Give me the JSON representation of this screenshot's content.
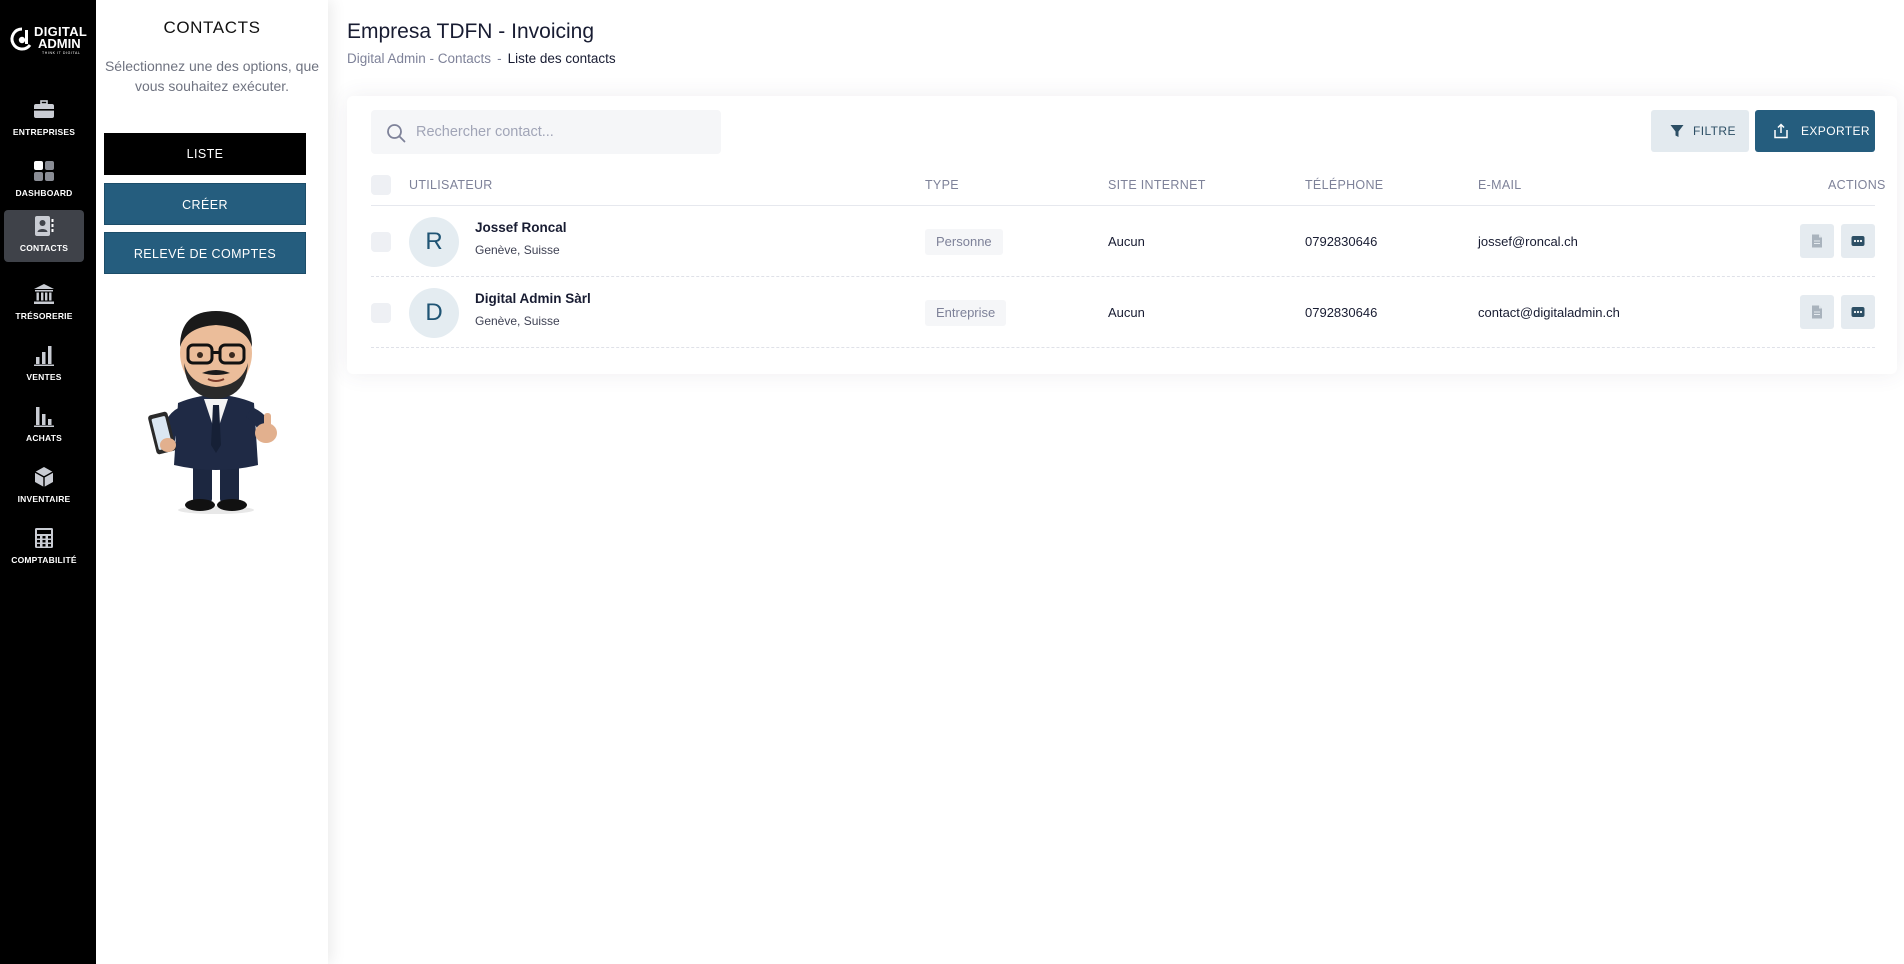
{
  "brand": {
    "line1": "DIGITAL",
    "line2": "ADMIN",
    "tagline": "THINK IT DIGITAL"
  },
  "nav": [
    {
      "label": "ENTREPRISES",
      "icon": "briefcase-icon"
    },
    {
      "label": "DASHBOARD",
      "icon": "dashboard-icon"
    },
    {
      "label": "CONTACTS",
      "icon": "contact-card-icon",
      "active": true
    },
    {
      "label": "TRÉSORERIE",
      "icon": "bank-icon"
    },
    {
      "label": "VENTES",
      "icon": "bar-chart-icon"
    },
    {
      "label": "ACHATS",
      "icon": "bar-chart-icon"
    },
    {
      "label": "INVENTAIRE",
      "icon": "box-icon"
    },
    {
      "label": "COMPTABILITÉ",
      "icon": "calculator-icon"
    }
  ],
  "sidebar": {
    "title": "CONTACTS",
    "subtitle": "Sélectionnez une des options, que vous souhaitez exécuter.",
    "buttons": [
      {
        "label": "LISTE"
      },
      {
        "label": "CRÉER"
      },
      {
        "label": "RELEVÉ DE COMPTES"
      }
    ]
  },
  "header": {
    "title": "Empresa TDFN - Invoicing",
    "breadcrumb": {
      "parent": "Digital Admin - Contacts",
      "separator": "-",
      "current": "Liste des contacts"
    }
  },
  "toolbar": {
    "search_placeholder": "Rechercher contact...",
    "filter_label": "FILTRE",
    "export_label": "EXPORTER"
  },
  "table": {
    "columns": {
      "user": "UTILISATEUR",
      "type": "TYPE",
      "website": "SITE INTERNET",
      "phone": "TÉLÉPHONE",
      "email": "E-MAIL",
      "actions": "ACTIONS"
    },
    "rows": [
      {
        "initial": "R",
        "name": "Jossef Roncal",
        "location": "Genève, Suisse",
        "type": "Personne",
        "website": "Aucun",
        "phone": "0792830646",
        "email": "jossef@roncal.ch"
      },
      {
        "initial": "D",
        "name": "Digital Admin Sàrl",
        "location": "Genève, Suisse",
        "type": "Entreprise",
        "website": "Aucun",
        "phone": "0792830646",
        "email": "contact@digitaladmin.ch"
      }
    ]
  },
  "colors": {
    "rail": "#000000",
    "rail_active": "#3f4249",
    "primary": "#255d7e",
    "filter_bg": "#e3eaef",
    "avatar_bg": "#e4ecf1"
  }
}
